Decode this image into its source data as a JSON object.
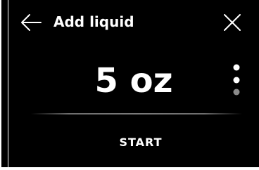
{
  "header": {
    "title": "Add liquid",
    "back_icon": "arrow-left-icon",
    "close_icon": "close-icon"
  },
  "main": {
    "value": "5 oz",
    "more_icon": "more-vertical-icon"
  },
  "footer": {
    "start_label": "START"
  },
  "colors": {
    "background": "#000000",
    "text": "#ffffff",
    "divider": "#7a7a7a",
    "dot_active": "#ffffff",
    "dot_inactive": "#8a8a8a"
  }
}
